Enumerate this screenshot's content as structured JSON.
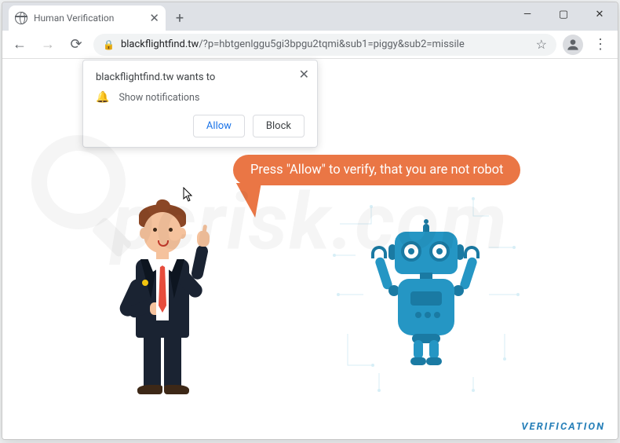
{
  "window": {
    "tab_title": "Human Verification",
    "controls": {
      "min": "—",
      "max": "▢",
      "close": "✕"
    },
    "newtab": "+"
  },
  "toolbar": {
    "back": "←",
    "forward": "→",
    "reload": "⟳",
    "lock": "🔒",
    "url_domain": "blackflightfind.tw",
    "url_rest": "/?p=hbtgenlggu5gi3bpgu2tqmi&sub1=piggy&sub2=missile",
    "star": "☆",
    "menu": "⋮"
  },
  "prompt": {
    "origin": "blackflightfind.tw wants to",
    "permission": "Show notifications",
    "bell": "🔔",
    "allow": "Allow",
    "block": "Block",
    "close": "✕"
  },
  "page": {
    "speech": "Press \"Allow\" to verify, that you are not robot",
    "footer": "VERIFICATION"
  },
  "watermark": "pcrisk.com"
}
